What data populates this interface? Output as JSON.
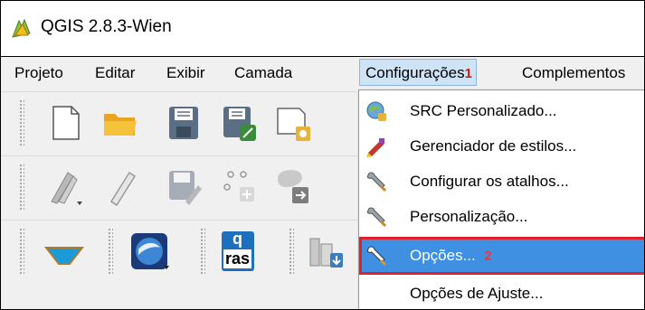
{
  "window": {
    "title": "QGIS 2.8.3-Wien"
  },
  "menubar": {
    "items": [
      "Projeto",
      "Editar",
      "Exibir",
      "Camada",
      "Configurações",
      "Complementos"
    ],
    "active_badge": "1"
  },
  "toolbar": {
    "icons": [
      "new-project-icon",
      "open-project-icon",
      "save-project-icon",
      "save-as-icon",
      "new-print-composer-icon",
      "digitize-icon",
      "toggle-editing-icon",
      "save-edits-icon",
      "add-feature-icon",
      "move-feature-icon",
      "water-level-icon",
      "google-earth-icon",
      "qras-icon",
      "build-plugin-icon"
    ],
    "qras_label_top": "q",
    "qras_label_bottom": "ras"
  },
  "dropdown": {
    "items": [
      {
        "label": "SRC Personalizado...",
        "icon": "globe-crs-icon"
      },
      {
        "label": "Gerenciador de estilos...",
        "icon": "style-manager-icon"
      },
      {
        "label": "Configurar os atalhos...",
        "icon": "wrench-icon"
      },
      {
        "label": "Personalização...",
        "icon": "wrench-icon"
      },
      {
        "label": "Opções...",
        "icon": "wrench-icon",
        "badge": "2"
      },
      {
        "label": "Opções de Ajuste...",
        "icon": ""
      }
    ]
  },
  "colors": {
    "highlight": "#3f8fe3",
    "callout_red": "#e0202a",
    "menu_active": "#cfe3f6"
  }
}
